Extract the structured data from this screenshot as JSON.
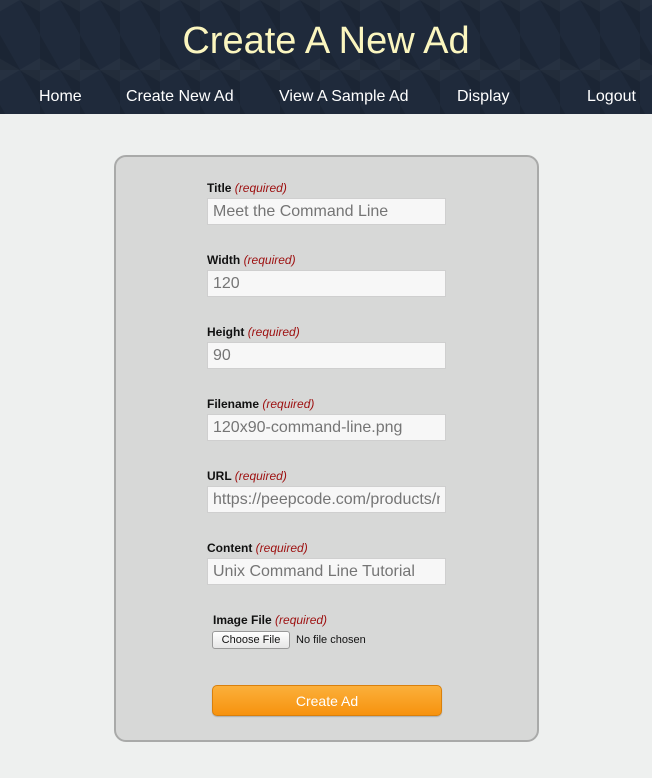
{
  "header": {
    "title": "Create A New Ad",
    "nav": {
      "home": "Home",
      "create": "Create New Ad",
      "sample": "View A Sample Ad",
      "display": "Display",
      "logout": "Logout"
    }
  },
  "form": {
    "required_text": "(required)",
    "title": {
      "label": "Title",
      "placeholder": "Meet the Command Line"
    },
    "width": {
      "label": "Width",
      "placeholder": "120"
    },
    "height": {
      "label": "Height",
      "placeholder": "90"
    },
    "filename": {
      "label": "Filename",
      "placeholder": "120x90-command-line.png"
    },
    "url": {
      "label": "URL",
      "placeholder": "https://peepcode.com/products/meet-the-command-line"
    },
    "content": {
      "label": "Content",
      "placeholder": "Unix Command Line Tutorial"
    },
    "image_file": {
      "label": "Image File",
      "button": "Choose File",
      "status": "No file chosen"
    },
    "submit": "Create Ad"
  },
  "colors": {
    "header_bg": "#1f2a3b",
    "title_color": "#fbf6bf",
    "required_color": "#9d0f0f",
    "button_orange": "#f7930e"
  }
}
